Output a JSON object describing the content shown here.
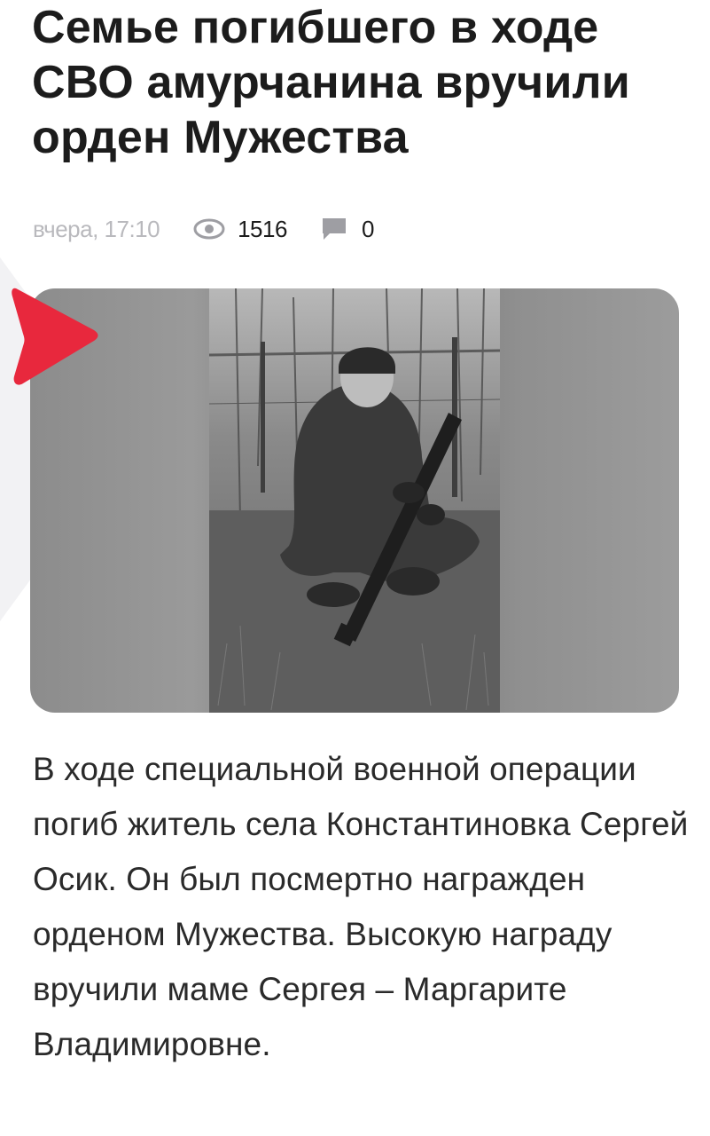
{
  "article": {
    "title": "Семье погибшего в ходе СВО амурчанина вручили орден Мужества",
    "meta": {
      "date": "вчера, 17:10",
      "views": "1516",
      "comments": "0",
      "views_icon": "eye-icon",
      "comments_icon": "comment-icon"
    },
    "image": {
      "type": "photo",
      "play_marker_icon": "play-triangle-icon",
      "marker_color": "#e8283d"
    },
    "lead": "В ходе специальной военной операции погиб житель села Константиновка Сергей Осик. Он был посмертно награжден орденом Мужества. Высокую награду вручили маме Сергея – Маргарите Владимировне."
  }
}
